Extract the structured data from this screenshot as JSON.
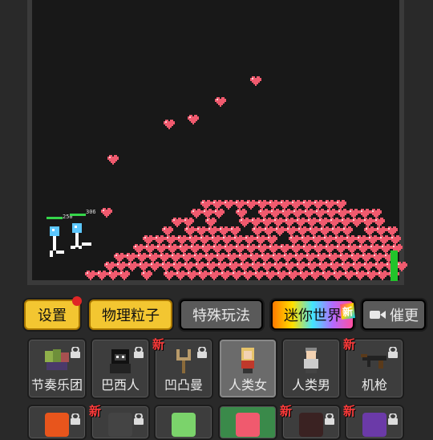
{
  "hud": {
    "player1_hp": "250",
    "player2_hp": "306"
  },
  "toolbar": {
    "settings": "设置",
    "physics_particles": "物理粒子",
    "special_play": "特殊玩法",
    "mini_world": "迷你世界",
    "mini_world_new": "新",
    "more_label": "催更"
  },
  "items": [
    {
      "label": "节奏乐团",
      "icon": "music-band-icon",
      "locked": true,
      "is_new": false,
      "badge": ""
    },
    {
      "label": "巴西人",
      "icon": "gorilla-icon",
      "locked": true,
      "is_new": false,
      "badge": ""
    },
    {
      "label": "凹凸曼",
      "icon": "slingshot-icon",
      "locked": true,
      "is_new": true,
      "badge": "新"
    },
    {
      "label": "人类女",
      "icon": "human-female-icon",
      "locked": false,
      "is_new": false,
      "badge": ""
    },
    {
      "label": "人类男",
      "icon": "human-male-icon",
      "locked": false,
      "is_new": false,
      "badge": ""
    },
    {
      "label": "机枪",
      "icon": "machine-gun-icon",
      "locked": true,
      "is_new": true,
      "badge": "新"
    }
  ],
  "row2": [
    {
      "icon": "fire-icon",
      "is_new": false,
      "badge": ""
    },
    {
      "icon": "pistol-icon",
      "is_new": true,
      "badge": "新"
    },
    {
      "icon": "potion-icon",
      "is_new": false,
      "badge": ""
    },
    {
      "icon": "heart-icon",
      "is_new": false,
      "badge": ""
    },
    {
      "icon": "dark-figure-icon",
      "is_new": true,
      "badge": "新"
    },
    {
      "icon": "wizard-hat-icon",
      "is_new": true,
      "badge": "新"
    }
  ],
  "colors": {
    "heart": "#f05a6e",
    "accent_yellow": "#f3c631",
    "hp_green": "#35d64a",
    "new_red": "#ff3b3b"
  }
}
